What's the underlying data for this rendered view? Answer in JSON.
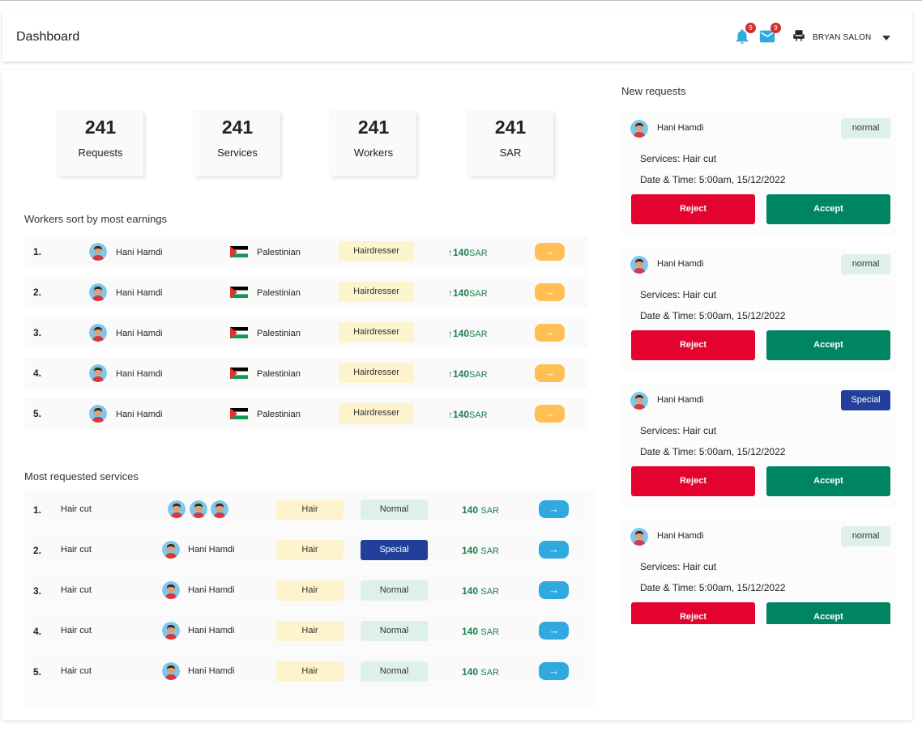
{
  "header": {
    "title": "Dashboard",
    "notifications_count": "9",
    "messages_count": "9",
    "salon_name": "BRYAN SALON"
  },
  "stats": [
    {
      "value": "241",
      "label": "Requests"
    },
    {
      "value": "241",
      "label": "Services"
    },
    {
      "value": "241",
      "label": "Workers"
    },
    {
      "value": "241",
      "label": "SAR"
    }
  ],
  "workers": {
    "title": "Workers sort by most earnings",
    "rows": [
      {
        "rank": "1.",
        "name": "Hani Hamdi",
        "nationality": "Palestinian",
        "role": "Hairdresser",
        "amount": "140",
        "currency": "SAR"
      },
      {
        "rank": "2.",
        "name": "Hani Hamdi",
        "nationality": "Palestinian",
        "role": "Hairdresser",
        "amount": "140",
        "currency": "SAR"
      },
      {
        "rank": "3.",
        "name": "Hani Hamdi",
        "nationality": "Palestinian",
        "role": "Hairdresser",
        "amount": "140",
        "currency": "SAR"
      },
      {
        "rank": "4.",
        "name": "Hani Hamdi",
        "nationality": "Palestinian",
        "role": "Hairdresser",
        "amount": "140",
        "currency": "SAR"
      },
      {
        "rank": "5.",
        "name": "Hani Hamdi",
        "nationality": "Palestinian",
        "role": "Hairdresser",
        "amount": "140",
        "currency": "SAR"
      }
    ],
    "arrow": "→"
  },
  "services": {
    "title": "Most requested services",
    "rows": [
      {
        "rank": "1.",
        "service": "Hair cut",
        "worker": "",
        "category": "Hair",
        "type": "Normal",
        "amount": "140",
        "currency": "SAR"
      },
      {
        "rank": "2.",
        "service": "Hair cut",
        "worker": "Hani Hamdi",
        "category": "Hair",
        "type": "Special",
        "amount": "140",
        "currency": "SAR"
      },
      {
        "rank": "3.",
        "service": "Hair cut",
        "worker": "Hani Hamdi",
        "category": "Hair",
        "type": "Normal",
        "amount": "140",
        "currency": "SAR"
      },
      {
        "rank": "4.",
        "service": "Hair cut",
        "worker": "Hani Hamdi",
        "category": "Hair",
        "type": "Normal",
        "amount": "140",
        "currency": "SAR"
      },
      {
        "rank": "5.",
        "service": "Hair cut",
        "worker": "Hani Hamdi",
        "category": "Hair",
        "type": "Normal",
        "amount": "140",
        "currency": "SAR"
      }
    ],
    "arrow": "→"
  },
  "requests": {
    "title": "New requests",
    "cards": [
      {
        "name": "Hani Hamdi",
        "badge": "normal",
        "services": "Services:  Hair cut",
        "datetime": "Date & Time:  5:00am, 15/12/2022",
        "reject": "Reject",
        "accept": "Accept"
      },
      {
        "name": "Hani Hamdi",
        "badge": "normal",
        "services": "Services:  Hair cut",
        "datetime": "Date & Time:  5:00am, 15/12/2022",
        "reject": "Reject",
        "accept": "Accept"
      },
      {
        "name": "Hani Hamdi",
        "badge": "Special",
        "services": "Services:  Hair cut",
        "datetime": "Date & Time:  5:00am, 15/12/2022",
        "reject": "Reject",
        "accept": "Accept"
      },
      {
        "name": "Hani Hamdi",
        "badge": "normal",
        "services": "Services:  Hair cut",
        "datetime": "Date & Time:  5:00am, 15/12/2022",
        "reject": "Reject",
        "accept": "Accept"
      }
    ]
  },
  "colors": {
    "reject": "#e4022f",
    "accept": "#008562",
    "special": "#22409a",
    "earnings": "#1b7f4c",
    "arrow_orange": "#ffbf52",
    "arrow_blue": "#2fa9e0"
  },
  "icons": [
    "bell-icon",
    "mail-icon",
    "salon-chair-icon",
    "caret-down-icon",
    "avatar-icon",
    "palestine-flag-icon",
    "up-arrow-icon",
    "right-arrow-icon"
  ]
}
